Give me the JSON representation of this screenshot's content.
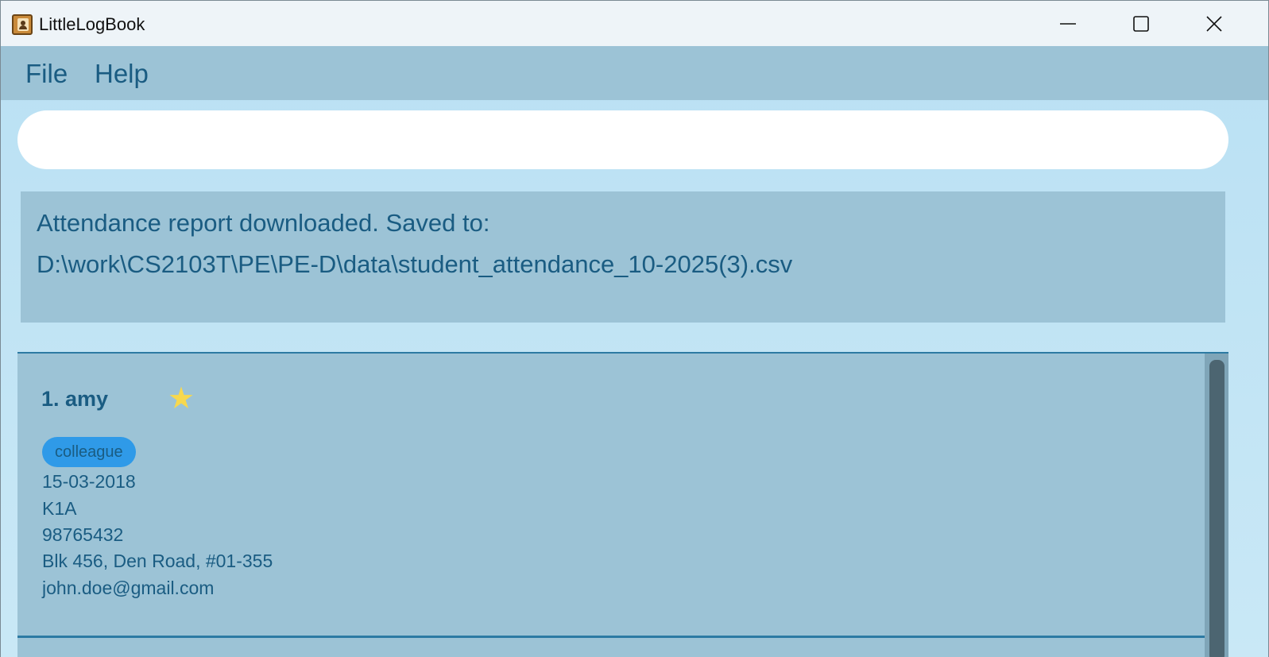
{
  "window": {
    "title": "LittleLogBook",
    "icon": "address-book-icon"
  },
  "menu": {
    "file_label": "File",
    "help_label": "Help"
  },
  "command": {
    "value": "",
    "placeholder": ""
  },
  "result": {
    "line1": "Attendance report downloaded. Saved to:",
    "line2": "D:\\work\\CS2103T\\PE\\PE-D\\data\\student_attendance_10-2025(3).csv"
  },
  "persons": [
    {
      "index_name": "1. amy",
      "starred": true,
      "star_icon": "star-icon",
      "tags": [
        "colleague"
      ],
      "date": "15-03-2018",
      "class": "K1A",
      "phone": "98765432",
      "address": "Blk 456, Den Road, #01-355",
      "email": "john.doe@gmail.com"
    }
  ],
  "colors": {
    "menu_bg": "#9cc3d6",
    "text_accent": "#1a5c82",
    "tag_bg": "#2f9ae8",
    "star": "#f7d84e",
    "window_bg": "#b9e0f3"
  }
}
